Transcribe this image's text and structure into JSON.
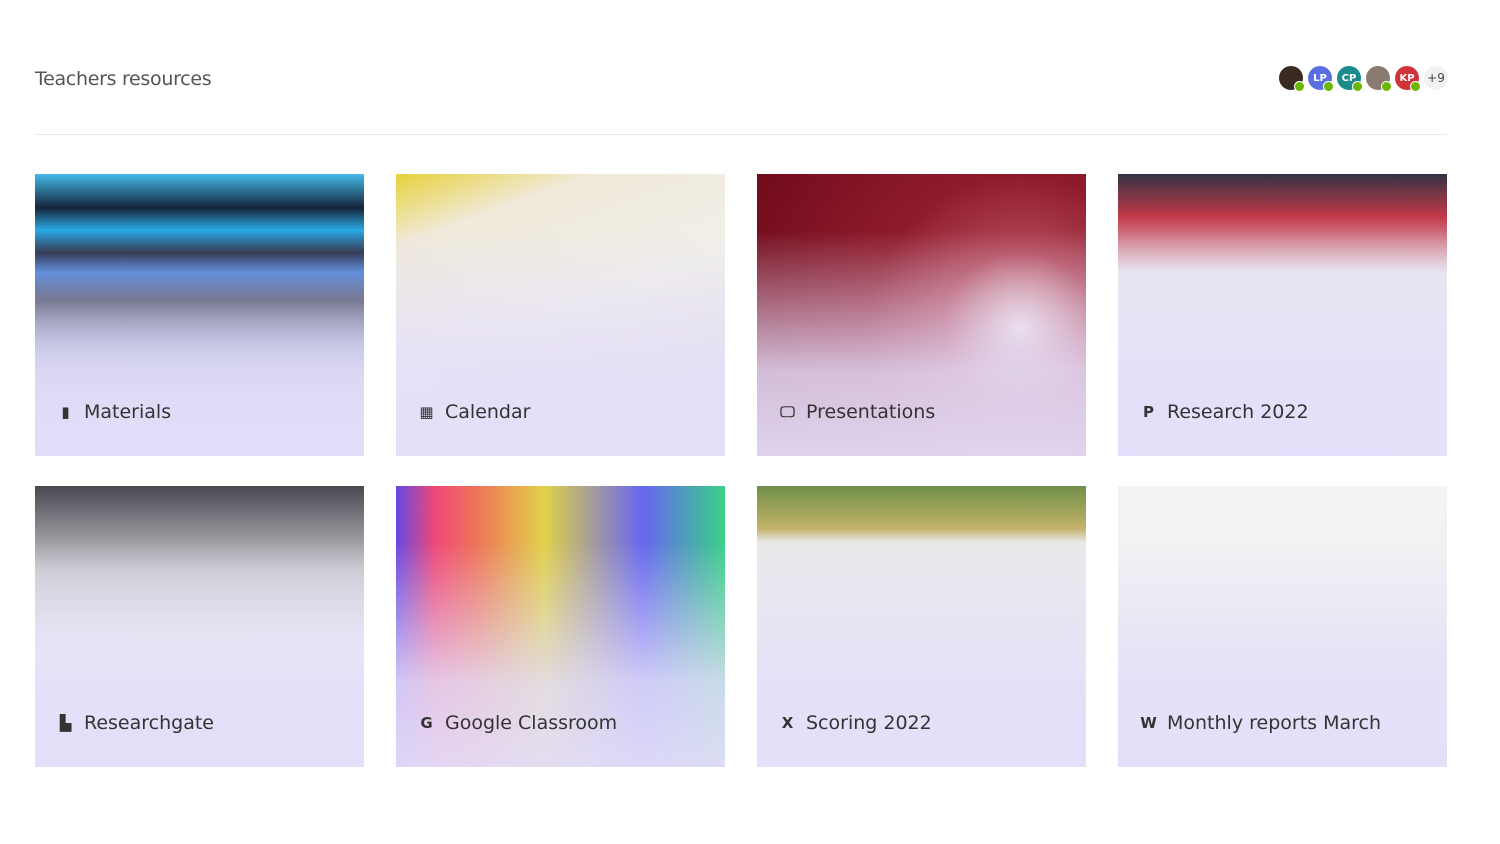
{
  "header": {
    "title": "Teachers resources",
    "avatars": [
      {
        "initials": "",
        "color": "#3a2a22",
        "status": "available"
      },
      {
        "initials": "LP",
        "color": "#5b6fe0",
        "status": "available"
      },
      {
        "initials": "CP",
        "color": "#1a8a8a",
        "status": "available"
      },
      {
        "initials": "",
        "color": "#8a7a70",
        "status": "available"
      },
      {
        "initials": "KP",
        "color": "#d13438",
        "status": "available"
      }
    ],
    "more_count": "+9"
  },
  "tiles": [
    {
      "label": "Materials",
      "icon": "notebook-icon",
      "glyph": "▮",
      "bg": "linear-gradient(180deg,#3ab8e8 0%,#0a1a30 12%,#20a8e8 20%,#101830 28%,#3070d0 35%,#202840 45%,#8090b0 60%,#c0c8e0 80%)"
    },
    {
      "label": "Calendar",
      "icon": "calendar-icon",
      "glyph": "▦",
      "bg": "linear-gradient(160deg,#e8d030 0%,#f0ead8 18%,#f2f0ea 50%,#e0dcd8 100%)"
    },
    {
      "label": "Presentations",
      "icon": "monitor-icon",
      "glyph": "🖵",
      "bg": "radial-gradient(circle at 80% 55%,#f0e0e0 0%,#b04050 25%,#8a1020 50%,#6a0010 100%)"
    },
    {
      "label": "Research 2022",
      "icon": "powerpoint-icon",
      "glyph": "P",
      "bg": "linear-gradient(180deg,#2a2a3a 0%,#c03040 15%,#e8e8ee 35%,#f0f0f4 100%)"
    },
    {
      "label": "Researchgate",
      "icon": "document-icon",
      "glyph": "▙",
      "bg": "linear-gradient(180deg,#404048 0%,#c8c8cc 30%,#f0f0f2 60%,#e8e8ec 100%)"
    },
    {
      "label": "Google Classroom",
      "icon": "google-icon",
      "glyph": "G",
      "bg": "linear-gradient(90deg,#6040e0 0%,#f04070 12%,#f07050 25%,#e0d040 45%,#6060f0 75%,#30d080 100%)"
    },
    {
      "label": "Scoring 2022",
      "icon": "excel-icon",
      "glyph": "X",
      "bg": "linear-gradient(180deg,#6a8a40 0%,#c0b060 15%,#e8e8e8 20%,#f0f0f0 100%)"
    },
    {
      "label": "Monthly reports March",
      "icon": "word-icon",
      "glyph": "W",
      "bg": "linear-gradient(180deg,#f4f4f4 0%,#ececec 100%)"
    }
  ]
}
